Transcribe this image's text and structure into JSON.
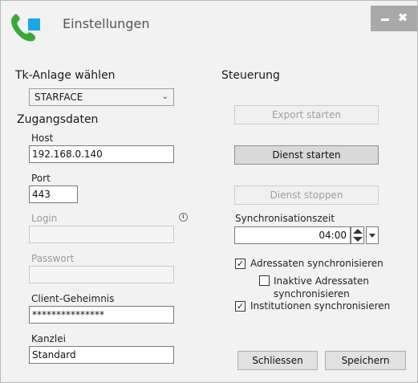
{
  "window": {
    "title": "Einstellungen",
    "minimize_icon": "minimize-icon",
    "close_label": "✖"
  },
  "left": {
    "tk_section": "Tk-Anlage wählen",
    "tk_selected": "STARFACE",
    "zugang_section": "Zugangsdaten",
    "host_label": "Host",
    "host_value": "192.168.0.140",
    "port_label": "Port",
    "port_value": "443",
    "login_label": "Login",
    "login_value": "",
    "passwort_label": "Passwort",
    "passwort_value": "",
    "client_label": "Client-Geheimnis",
    "client_value": "***************",
    "kanzlei_label": "Kanzlei",
    "kanzlei_value": "Standard"
  },
  "right": {
    "steuerung_section": "Steuerung",
    "export_button": "Export starten",
    "dienst_starten_button": "Dienst starten",
    "dienst_stoppen_button": "Dienst stoppen",
    "sync_zeit_label": "Synchronisationszeit",
    "sync_zeit_value": "04:00",
    "cb_adressaten": "Adressaten synchronisieren",
    "cb_adressaten_checked": true,
    "cb_inaktive": "Inaktive Adressaten synchronisieren",
    "cb_inaktive_checked": false,
    "cb_institutionen": "Institutionen synchronisieren",
    "cb_institutionen_checked": true
  },
  "footer": {
    "schliessen_button": "Schliessen",
    "speichern_button": "Speichern"
  },
  "colors": {
    "window_bg": "#f2f2f2",
    "icon_green": "#3aa93a",
    "icon_blue": "#1aa7e6",
    "titlebar_controls_bg": "#a9a9a9"
  }
}
